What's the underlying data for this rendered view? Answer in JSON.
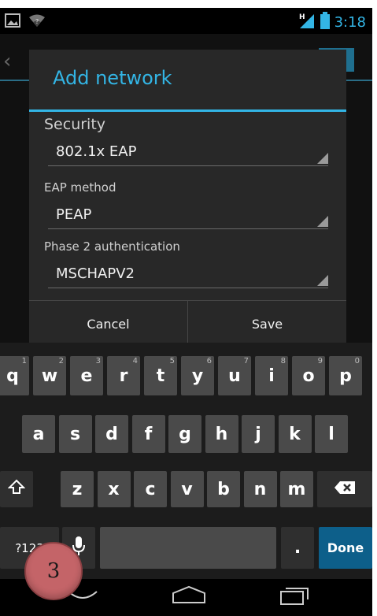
{
  "status_bar": {
    "time": "3:18",
    "network_type": "H",
    "icons": [
      "image-icon",
      "wifi-icon",
      "signal-icon",
      "battery-icon"
    ]
  },
  "dialog": {
    "title": "Add network",
    "security_label": "Security",
    "security_value": "802.1x EAP",
    "eap_label": "EAP method",
    "eap_value": "PEAP",
    "phase2_label": "Phase 2 authentication",
    "phase2_value": "MSCHAPV2",
    "cancel_label": "Cancel",
    "save_label": "Save"
  },
  "keyboard": {
    "row1": [
      {
        "k": "q",
        "h": "1"
      },
      {
        "k": "w",
        "h": "2"
      },
      {
        "k": "e",
        "h": "3"
      },
      {
        "k": "r",
        "h": "4"
      },
      {
        "k": "t",
        "h": "5"
      },
      {
        "k": "y",
        "h": "6"
      },
      {
        "k": "u",
        "h": "7"
      },
      {
        "k": "i",
        "h": "8"
      },
      {
        "k": "o",
        "h": "9"
      },
      {
        "k": "p",
        "h": "0"
      }
    ],
    "row2": [
      "a",
      "s",
      "d",
      "f",
      "g",
      "h",
      "j",
      "k",
      "l"
    ],
    "row3": [
      "z",
      "x",
      "c",
      "v",
      "b",
      "n",
      "m"
    ],
    "symbols_label": "?123",
    "period_label": ".",
    "done_label": "Done",
    "icons": [
      "shift-icon",
      "backspace-icon",
      "mic-icon"
    ]
  },
  "annotation": {
    "number": "3"
  },
  "colors": {
    "accent": "#33b5e5",
    "dialog_bg": "#282828",
    "key_bg": "#4a4a4a",
    "done_bg": "#0d5f8a",
    "badge": "#c46468"
  }
}
